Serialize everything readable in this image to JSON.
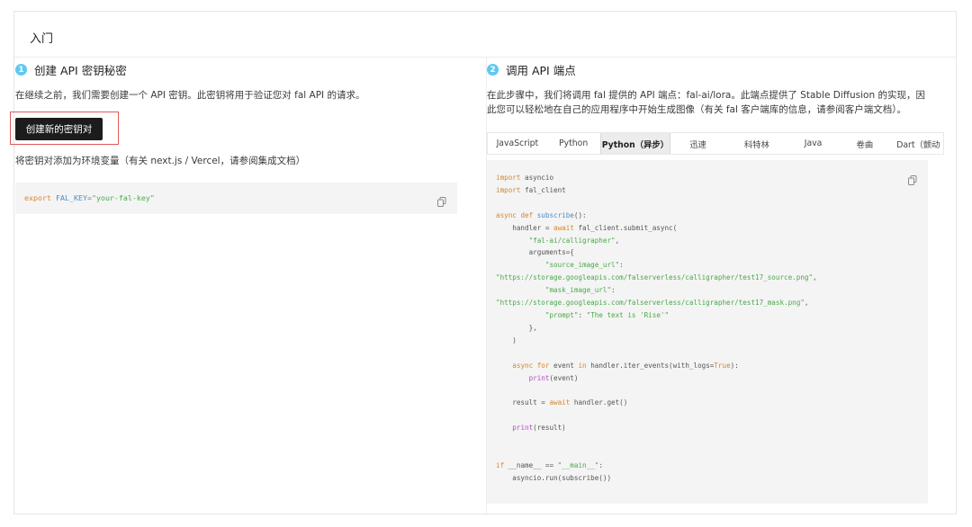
{
  "card": {
    "title": "入门"
  },
  "step1": {
    "number": "1",
    "title": "创建 API 密钥秘密",
    "description": "在继续之前，我们需要创建一个 API 密钥。此密钥将用于验证您对 fal API 的请求。",
    "button_label": "创建新的密钥对",
    "note": "将密钥对添加为环境变量（有关 next.js / Vercel，请参阅集成文档）",
    "env_code": {
      "keyword": "export",
      "name": "FAL_KEY",
      "equals": "=",
      "value": "\"your-fal-key\""
    }
  },
  "step2": {
    "number": "2",
    "title": "调用 API 端点",
    "description": "在此步骤中，我们将调用 fal 提供的 API 端点：fal-ai/lora。此端点提供了 Stable Diffusion 的实现，因此您可以轻松地在自己的应用程序中开始生成图像（有关 fal 客户端库的信息，请参阅客户端文档）。",
    "tabs": [
      {
        "label": "JavaScript",
        "active": false
      },
      {
        "label": "Python",
        "active": false
      },
      {
        "label": "Python（异步）",
        "active": true
      },
      {
        "label": "迅速",
        "active": false
      },
      {
        "label": "科特林",
        "active": false
      },
      {
        "label": "Java",
        "active": false
      },
      {
        "label": "卷曲",
        "active": false
      },
      {
        "label": "Dart（颤动",
        "active": false
      }
    ],
    "code_lines": [
      "import asyncio",
      "import fal_client",
      "",
      "async def subscribe():",
      "    handler = await fal_client.submit_async(",
      "        \"fal-ai/calligrapher\",",
      "        arguments={",
      "            \"source_image_url\":",
      "\"https://storage.googleapis.com/falserverless/calligrapher/test17_source.png\",",
      "            \"mask_image_url\":",
      "\"https://storage.googleapis.com/falserverless/calligrapher/test17_mask.png\",",
      "            \"prompt\": \"The text is 'Rise'\"",
      "        },",
      "    )",
      "",
      "    async for event in handler.iter_events(with_logs=True):",
      "        print(event)",
      "",
      "    result = await handler.get()",
      "",
      "    print(result)",
      "",
      "",
      "if __name__ == \"__main__\":",
      "    asyncio.run(subscribe())"
    ]
  },
  "icons": {
    "copy": "copy-icon"
  },
  "colors": {
    "step_badge": "#5fc8f1",
    "button_bg": "#1c1c1c",
    "highlight_border": "#e05a5a",
    "code_bg": "#f4f4f4",
    "code_keyword": "#d5872b",
    "code_string": "#4aa84a",
    "code_var": "#4a8cc9",
    "code_builtin": "#b548c6"
  }
}
